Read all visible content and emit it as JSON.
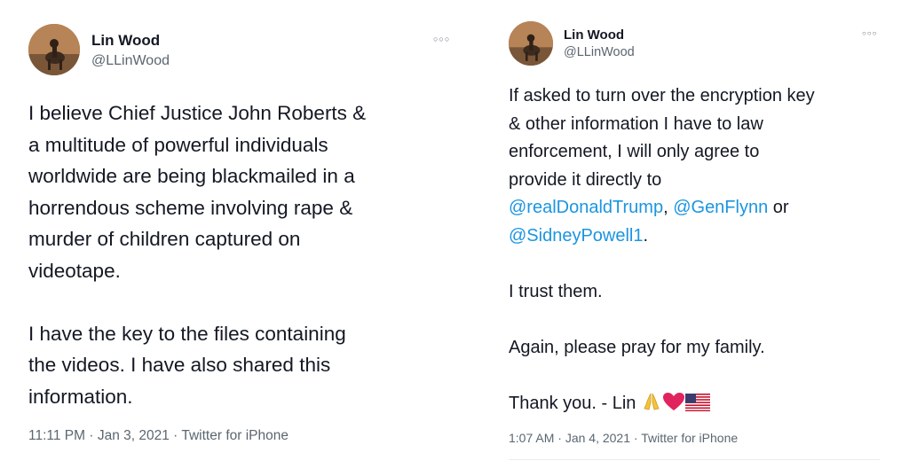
{
  "tweet_left": {
    "display_name": "Lin Wood",
    "handle": "@LLinWood",
    "more_icon": "more-options-icon",
    "lines": [
      "I believe Chief Justice John Roberts &",
      "a multitude of powerful individuals",
      "worldwide are being blackmailed in a",
      "horrendous scheme involving rape &",
      "murder of children captured on",
      "videotape.",
      "I have the key to the files containing",
      "the videos. I have also shared this",
      "information."
    ],
    "time": "11:11 PM",
    "sep1": "·",
    "date": "Jan 3, 2021",
    "sep2": "·",
    "source": "Twitter for iPhone"
  },
  "tweet_right": {
    "display_name": "Lin Wood",
    "handle": "@LLinWood",
    "more_icon": "more-options-icon",
    "line1": "If asked to turn over the encryption key",
    "line2": "& other information I have to law",
    "line3": "enforcement, I will only agree to",
    "line4": "provide it directly to",
    "mention1": "@realDonaldTrump",
    "comma": ", ",
    "mention2": "@GenFlynn",
    "or_text": " or",
    "mention3": "@SidneyPowell1",
    "period": ".",
    "line7": "I trust them.",
    "line8": "Again, please pray for my family.",
    "line9": "Thank you. - Lin",
    "emojis": [
      "praying-hands-icon",
      "red-heart-icon",
      "us-flag-icon"
    ],
    "time": "1:07 AM",
    "sep1": "·",
    "date": "Jan 4, 2021",
    "sep2": "·",
    "source": "Twitter for iPhone"
  },
  "colors": {
    "text": "#141823",
    "secondary": "#5b6670",
    "link": "#1b95e0",
    "divider": "#e6ecf0",
    "heart": "#e0245e"
  }
}
